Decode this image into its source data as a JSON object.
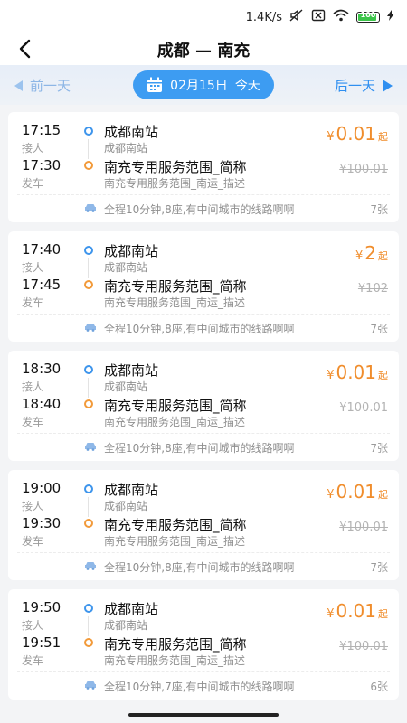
{
  "status_bar": {
    "speed": "1.4K/s",
    "battery": "100"
  },
  "header": {
    "title": "成都 — 南充"
  },
  "date_bar": {
    "prev_label": "前一天",
    "date_label": "02月15日",
    "today_label": "今天",
    "next_label": "后一天"
  },
  "colors": {
    "accent_blue": "#3d9cf2",
    "price_orange": "#f08d2c"
  },
  "trips": [
    {
      "depart_time": "17:15",
      "depart_label": "接人",
      "arrive_time": "17:30",
      "arrive_label": "发车",
      "from_station": "成都南站",
      "from_desc": "成都南站",
      "to_station": "南充专用服务范围_简称",
      "to_desc": "南充专用服务范围_南运_描述",
      "currency": "¥",
      "price": "0.01",
      "price_suffix": "起",
      "original_price": "¥100.01",
      "route_info": "全程10分钟,8座,有中间城市的线路啊啊",
      "seats": "7张"
    },
    {
      "depart_time": "17:40",
      "depart_label": "接人",
      "arrive_time": "17:45",
      "arrive_label": "发车",
      "from_station": "成都南站",
      "from_desc": "成都南站",
      "to_station": "南充专用服务范围_简称",
      "to_desc": "南充专用服务范围_南运_描述",
      "currency": "¥",
      "price": "2",
      "price_suffix": "起",
      "original_price": "¥102",
      "route_info": "全程10分钟,8座,有中间城市的线路啊啊",
      "seats": "7张"
    },
    {
      "depart_time": "18:30",
      "depart_label": "接人",
      "arrive_time": "18:40",
      "arrive_label": "发车",
      "from_station": "成都南站",
      "from_desc": "成都南站",
      "to_station": "南充专用服务范围_简称",
      "to_desc": "南充专用服务范围_南运_描述",
      "currency": "¥",
      "price": "0.01",
      "price_suffix": "起",
      "original_price": "¥100.01",
      "route_info": "全程10分钟,8座,有中间城市的线路啊啊",
      "seats": "7张"
    },
    {
      "depart_time": "19:00",
      "depart_label": "接人",
      "arrive_time": "19:30",
      "arrive_label": "发车",
      "from_station": "成都南站",
      "from_desc": "成都南站",
      "to_station": "南充专用服务范围_简称",
      "to_desc": "南充专用服务范围_南运_描述",
      "currency": "¥",
      "price": "0.01",
      "price_suffix": "起",
      "original_price": "¥100.01",
      "route_info": "全程10分钟,8座,有中间城市的线路啊啊",
      "seats": "7张"
    },
    {
      "depart_time": "19:50",
      "depart_label": "接人",
      "arrive_time": "19:51",
      "arrive_label": "发车",
      "from_station": "成都南站",
      "from_desc": "成都南站",
      "to_station": "南充专用服务范围_简称",
      "to_desc": "南充专用服务范围_南运_描述",
      "currency": "¥",
      "price": "0.01",
      "price_suffix": "起",
      "original_price": "¥100.01",
      "route_info": "全程10分钟,7座,有中间城市的线路啊啊",
      "seats": "6张"
    }
  ]
}
